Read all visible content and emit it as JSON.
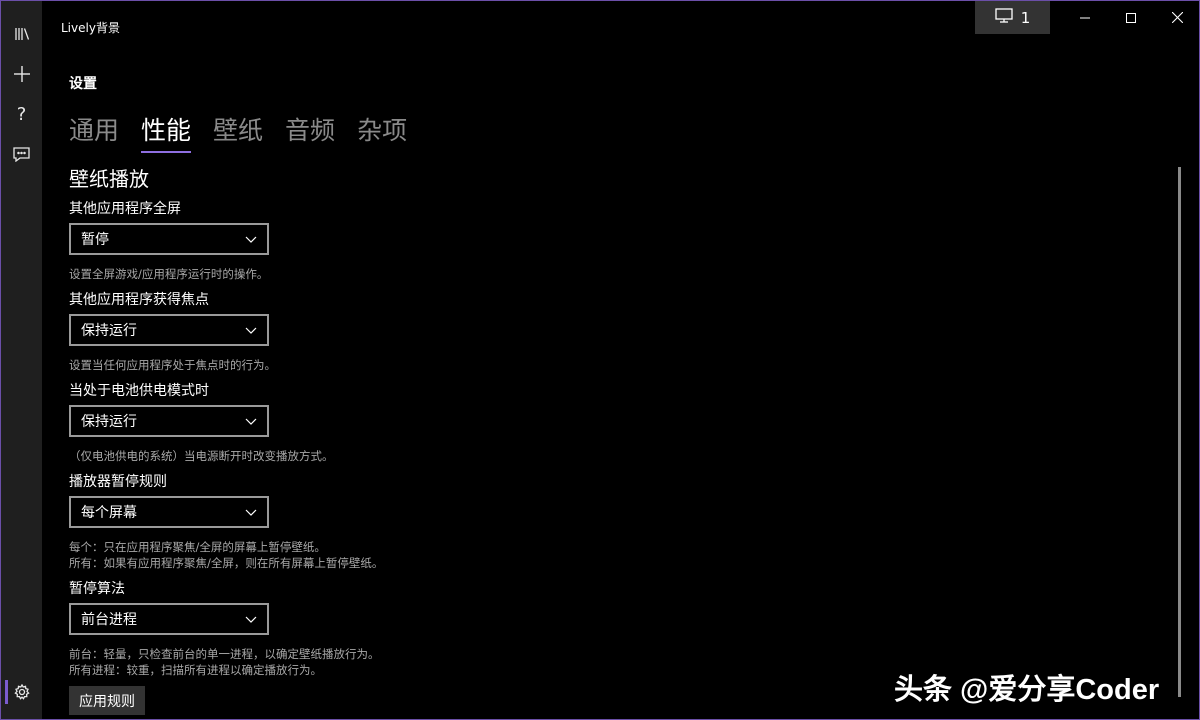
{
  "window": {
    "title": "Lively背景"
  },
  "titlebar": {
    "monitor_count": "1"
  },
  "page": {
    "title": "设置"
  },
  "tabs": [
    {
      "label": "通用"
    },
    {
      "label": "性能"
    },
    {
      "label": "壁纸"
    },
    {
      "label": "音频"
    },
    {
      "label": "杂项"
    }
  ],
  "active_tab": "性能",
  "section": {
    "title": "壁纸播放"
  },
  "settings": [
    {
      "label": "其他应用程序全屏",
      "value": "暂停",
      "desc": [
        "设置全屏游戏/应用程序运行时的操作。"
      ]
    },
    {
      "label": "其他应用程序获得焦点",
      "value": "保持运行",
      "desc": [
        "设置当任何应用程序处于焦点时的行为。"
      ]
    },
    {
      "label": "当处于电池供电模式时",
      "value": "保持运行",
      "desc": [
        "（仅电池供电的系统）当电源断开时改变播放方式。"
      ]
    },
    {
      "label": "播放器暂停规则",
      "value": "每个屏幕",
      "desc": [
        "每个：只在应用程序聚焦/全屏的屏幕上暂停壁纸。",
        "所有：如果有应用程序聚焦/全屏，则在所有屏幕上暂停壁纸。"
      ]
    },
    {
      "label": "暂停算法",
      "value": "前台进程",
      "desc": [
        "前台：轻量，只检查前台的单一进程，以确定壁纸播放行为。",
        "所有进程：较重，扫描所有进程以确定播放行为。"
      ]
    }
  ],
  "apply_button": {
    "label": "应用规则"
  },
  "watermark": "头条 @爱分享Coder",
  "sidebar": [
    {
      "name": "library-icon"
    },
    {
      "name": "add-icon"
    },
    {
      "name": "help-icon"
    },
    {
      "name": "feedback-icon"
    },
    {
      "name": "settings-icon"
    }
  ],
  "colors": {
    "accent": "#8e6ee0",
    "background": "#000000",
    "sidebar": "#1f1f1f",
    "border": "#6b4fa8"
  }
}
